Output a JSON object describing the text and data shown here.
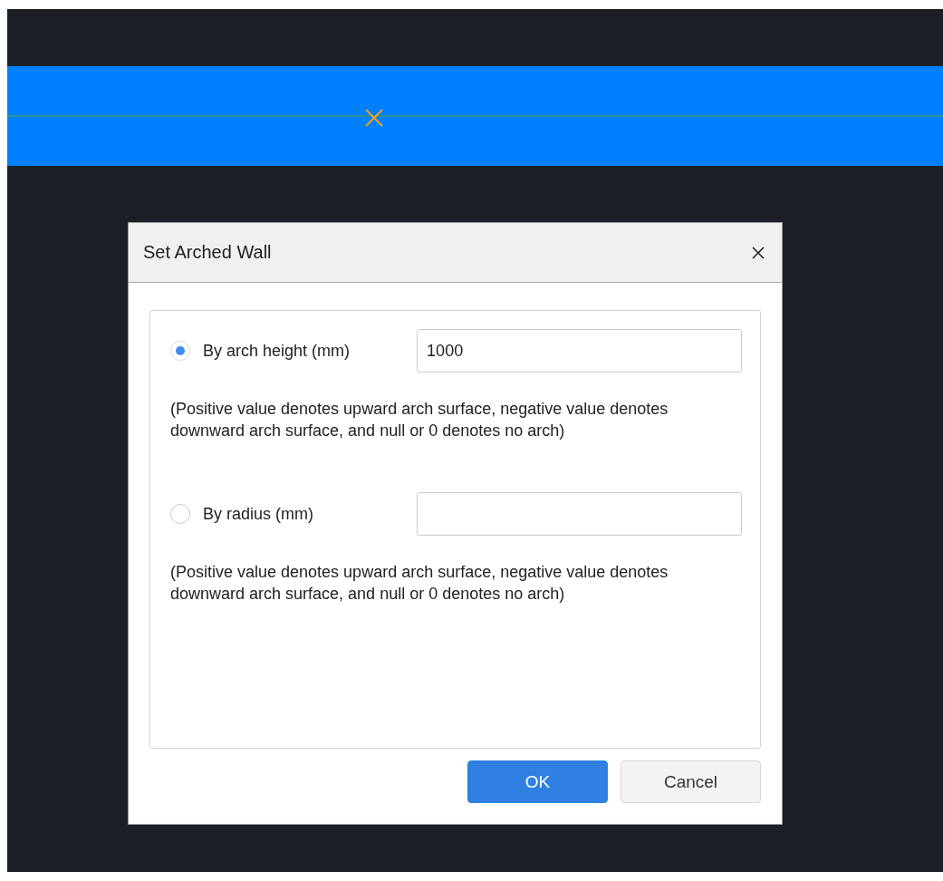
{
  "dialog": {
    "title": "Set Arched Wall",
    "options": [
      {
        "label": "By arch height (mm)",
        "selected": true,
        "value": "1000",
        "note": "(Positive value denotes upward arch surface, negative value denotes downward arch surface, and null or 0 denotes no arch)"
      },
      {
        "label": "By radius (mm)",
        "selected": false,
        "note": "(Positive value denotes upward arch surface, negative value denotes downward arch surface, and null or 0 denotes no arch)"
      }
    ],
    "buttons": [
      {
        "label": "OK",
        "kind": "primary"
      },
      {
        "label": "Cancel",
        "kind": "secondary"
      }
    ]
  }
}
